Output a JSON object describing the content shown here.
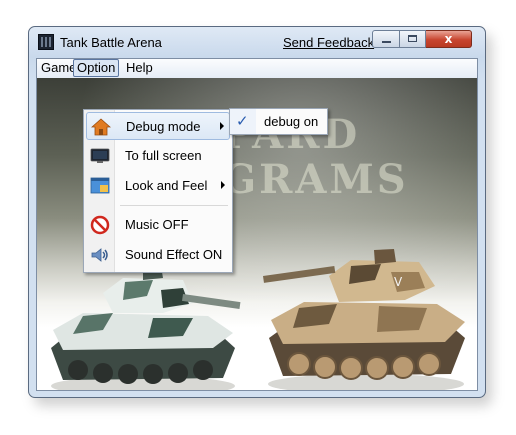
{
  "window": {
    "title": "Tank Battle Arena",
    "feedback_link": "Send Feedback",
    "close_glyph": "x"
  },
  "menubar": {
    "items": [
      "Game",
      "Option",
      "Help"
    ]
  },
  "option_menu": {
    "items": [
      {
        "label": "Debug mode",
        "icon": "home-icon",
        "has_submenu": true
      },
      {
        "label": "To full screen",
        "icon": "monitor-icon",
        "has_submenu": false
      },
      {
        "label": "Look and Feel",
        "icon": "window-icon",
        "has_submenu": true
      },
      {
        "label": "Music OFF",
        "icon": "no-symbol-icon",
        "has_submenu": false
      },
      {
        "label": "Sound Effect ON",
        "icon": "speaker-icon",
        "has_submenu": false
      }
    ]
  },
  "debug_submenu": {
    "check_glyph": "✓",
    "item": "debug on"
  },
  "background": {
    "line1": "PARD",
    "line2": "GRAMS"
  },
  "colors": {
    "accent": "#2a5db0",
    "close_button": "#c8452f"
  }
}
